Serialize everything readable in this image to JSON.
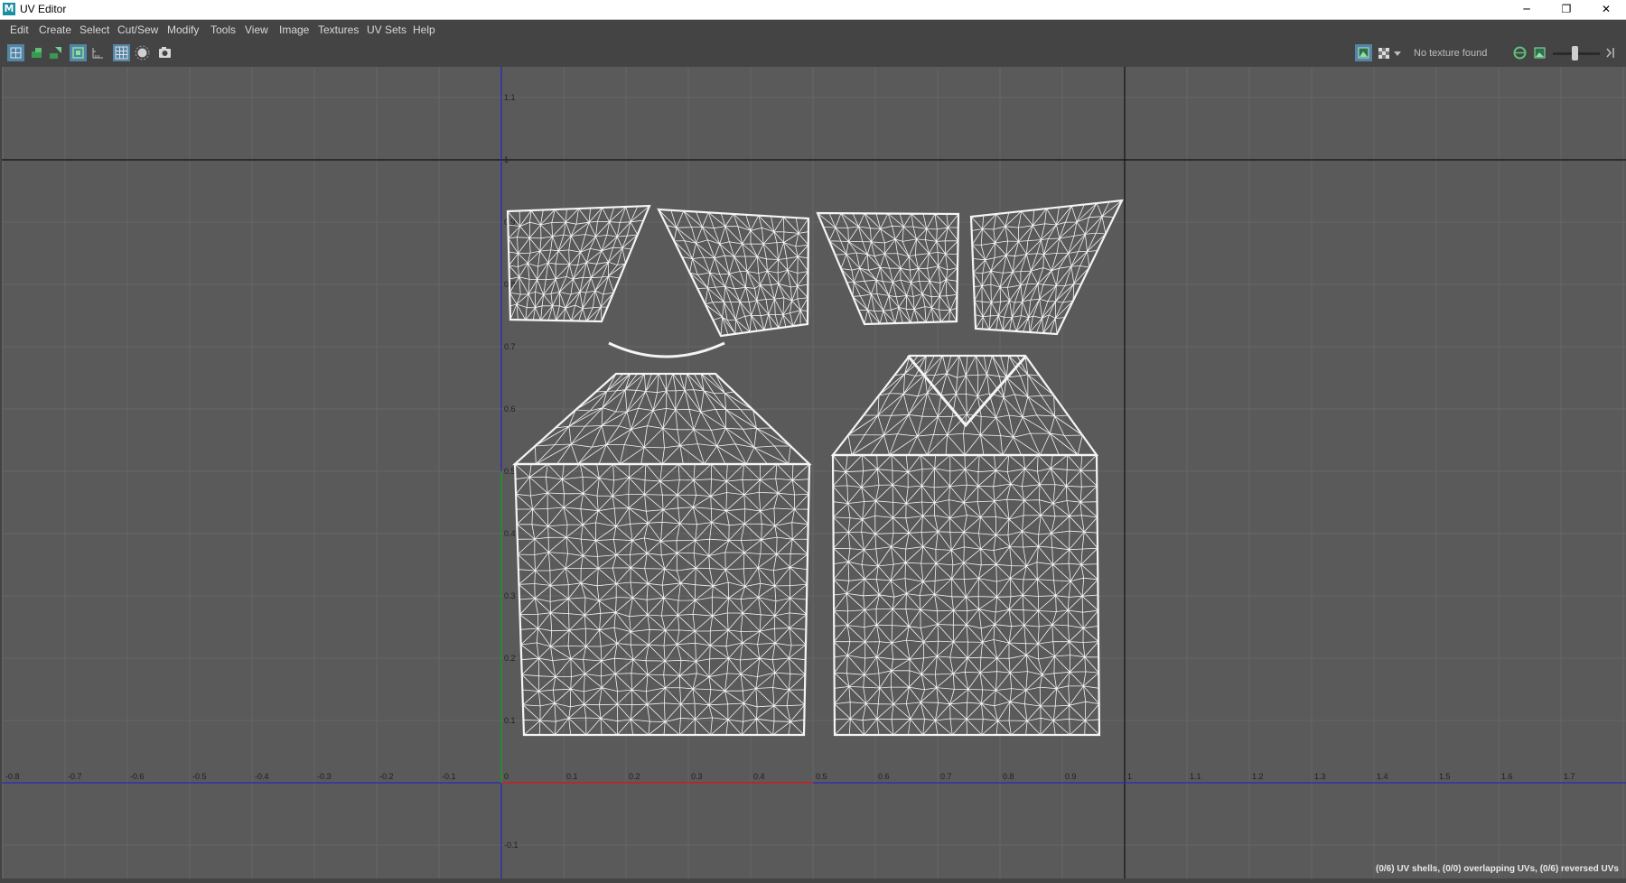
{
  "window": {
    "title": "UV Editor",
    "app_icon": "M",
    "minimize_symbol": "─",
    "restore_symbol": "❐",
    "close_symbol": "✕"
  },
  "menu": [
    "Edit",
    "Create",
    "Select",
    "Cut/Sew",
    "Modify",
    "Tools",
    "View",
    "Image",
    "Textures",
    "UV Sets",
    "Help"
  ],
  "toolbar": {
    "left_icons": [
      "uv-shell-select-icon",
      "uv-select-icon",
      "uv-move-icon",
      "grid-frame-icon",
      "ruler-icon",
      "pixel-grid-icon",
      "shading-icon",
      "snapshot-icon"
    ],
    "right_icons": [
      "display-image-icon",
      "checker-icon",
      "dropdown-arrow-icon",
      "exposure-icon",
      "image-icon",
      "zoom-slider-icon"
    ],
    "texture_status": "No texture found"
  },
  "viewport": {
    "background": "#5a5a5a",
    "u_axis_color": "#2a2ab8",
    "v_axis_color": "#2a2ab8",
    "u_positive_color": "#cc2222",
    "v_positive_color": "#1fa01f",
    "u_ticks": [
      "-0.8",
      "-0.7",
      "-0.6",
      "-0.5",
      "-0.4",
      "-0.3",
      "-0.2",
      "-0.1",
      "0",
      "0.1",
      "0.2",
      "0.3",
      "0.4",
      "0.5",
      "0.6",
      "0.7",
      "0.8",
      "0.9",
      "1",
      "1.1",
      "1.2",
      "1.3",
      "1.4",
      "1.5",
      "1.6",
      "1.7"
    ],
    "v_ticks": [
      "-0.1",
      "0.1",
      "0.2",
      "0.3",
      "0.4",
      "0.5",
      "0.6",
      "0.7",
      "0.8",
      "0.9",
      "1",
      "1.1"
    ],
    "uv_shells": [
      "sleeve-shell-1",
      "sleeve-shell-2",
      "sleeve-shell-3",
      "sleeve-shell-4",
      "back-panel-shell",
      "front-panel-shell"
    ]
  },
  "status": "(0/6) UV shells, (0/0) overlapping UVs, (0/6) reversed UVs"
}
